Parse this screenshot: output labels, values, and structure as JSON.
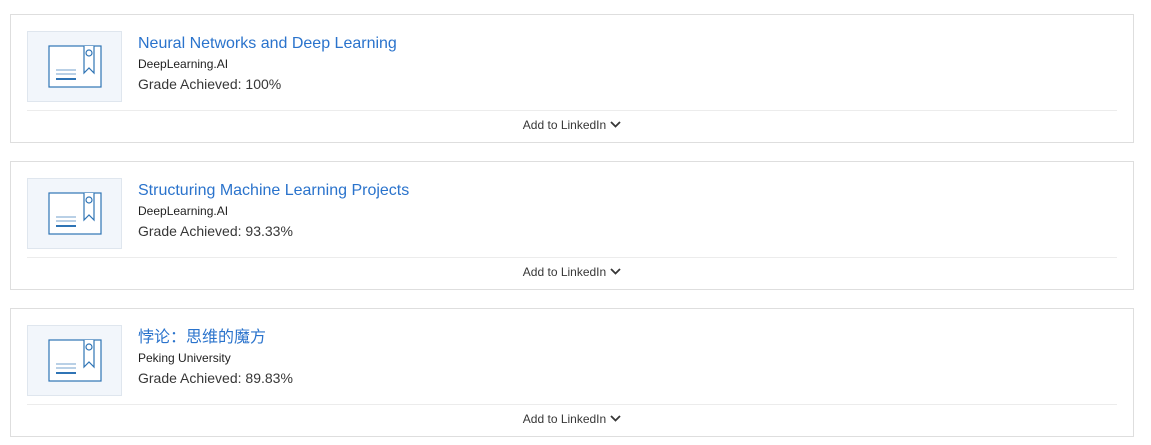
{
  "courses": [
    {
      "title": "Neural Networks and Deep Learning",
      "partner": "DeepLearning.AI",
      "grade_label": "Grade Achieved: ",
      "grade_value": "100%",
      "linkedin_label": "Add to LinkedIn",
      "icon": "certificate-icon"
    },
    {
      "title": "Structuring Machine Learning Projects",
      "partner": "DeepLearning.AI",
      "grade_label": "Grade Achieved: ",
      "grade_value": "93.33%",
      "linkedin_label": "Add to LinkedIn",
      "icon": "certificate-icon"
    },
    {
      "title": "悖论：思维的魔方",
      "partner": "Peking University",
      "grade_label": "Grade Achieved: ",
      "grade_value": "89.83%",
      "linkedin_label": "Add to LinkedIn",
      "icon": "certificate-icon"
    }
  ],
  "colors": {
    "link": "#2a73cc",
    "icon_stroke": "#2f74b5",
    "thumb_bg": "#f2f6fb",
    "border": "#dedede"
  }
}
